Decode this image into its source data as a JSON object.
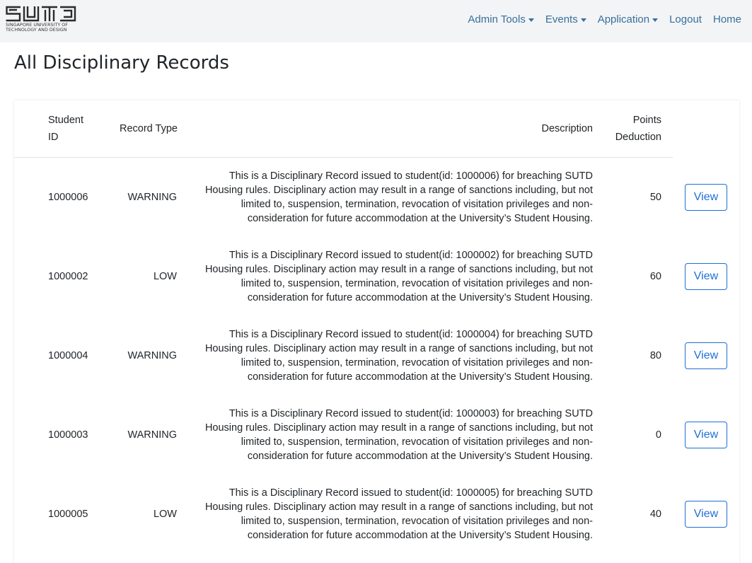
{
  "brand": {
    "logo_text": "SUTD",
    "line1": "SINGAPORE UNIVERSITY OF",
    "line2": "TECHNOLOGY AND DESIGN"
  },
  "nav": {
    "admin_tools": "Admin Tools",
    "events": "Events",
    "application": "Application",
    "logout": "Logout",
    "home": "Home"
  },
  "page": {
    "title": "All Disciplinary Records"
  },
  "table": {
    "headers": {
      "student_id_1": "Student",
      "student_id_2": "ID",
      "record_type": "Record Type",
      "description": "Description",
      "points_1": "Points",
      "points_2": "Deduction"
    },
    "view_label": "View",
    "rows": [
      {
        "student_id": "1000006",
        "record_type": "WARNING",
        "description_lines": [
          "This is a Disciplinary Record issued to student(id: 1000006) for breaching SUTD",
          "Housing rules. Disciplinary action may result in a range of sanctions including, but not",
          "limited to, suspension, termination, revocation of visitation privileges and non-",
          "consideration for future accommodation at the University’s Student Housing."
        ],
        "points": "50"
      },
      {
        "student_id": "1000002",
        "record_type": "LOW",
        "description_lines": [
          "This is a Disciplinary Record issued to student(id: 1000002) for breaching SUTD",
          "Housing rules. Disciplinary action may result in a range of sanctions including, but not",
          "limited to, suspension, termination, revocation of visitation privileges and non-",
          "consideration for future accommodation at the University’s Student Housing."
        ],
        "points": "60"
      },
      {
        "student_id": "1000004",
        "record_type": "WARNING",
        "description_lines": [
          "This is a Disciplinary Record issued to student(id: 1000004) for breaching SUTD",
          "Housing rules. Disciplinary action may result in a range of sanctions including, but not",
          "limited to, suspension, termination, revocation of visitation privileges and non-",
          "consideration for future accommodation at the University’s Student Housing."
        ],
        "points": "80"
      },
      {
        "student_id": "1000003",
        "record_type": "WARNING",
        "description_lines": [
          "This is a Disciplinary Record issued to student(id: 1000003) for breaching SUTD",
          "Housing rules. Disciplinary action may result in a range of sanctions including, but not",
          "limited to, suspension, termination, revocation of visitation privileges and non-",
          "consideration for future accommodation at the University’s Student Housing."
        ],
        "points": "0"
      },
      {
        "student_id": "1000005",
        "record_type": "LOW",
        "description_lines": [
          "This is a Disciplinary Record issued to student(id: 1000005) for breaching SUTD",
          "Housing rules. Disciplinary action may result in a range of sanctions including, but not",
          "limited to, suspension, termination, revocation of visitation privileges and non-",
          "consideration for future accommodation at the University’s Student Housing."
        ],
        "points": "40"
      }
    ]
  },
  "colors": {
    "navbar_bg": "#f2f4f6",
    "nav_link": "#3a6f9a",
    "button_primary": "#1f6fd6"
  }
}
